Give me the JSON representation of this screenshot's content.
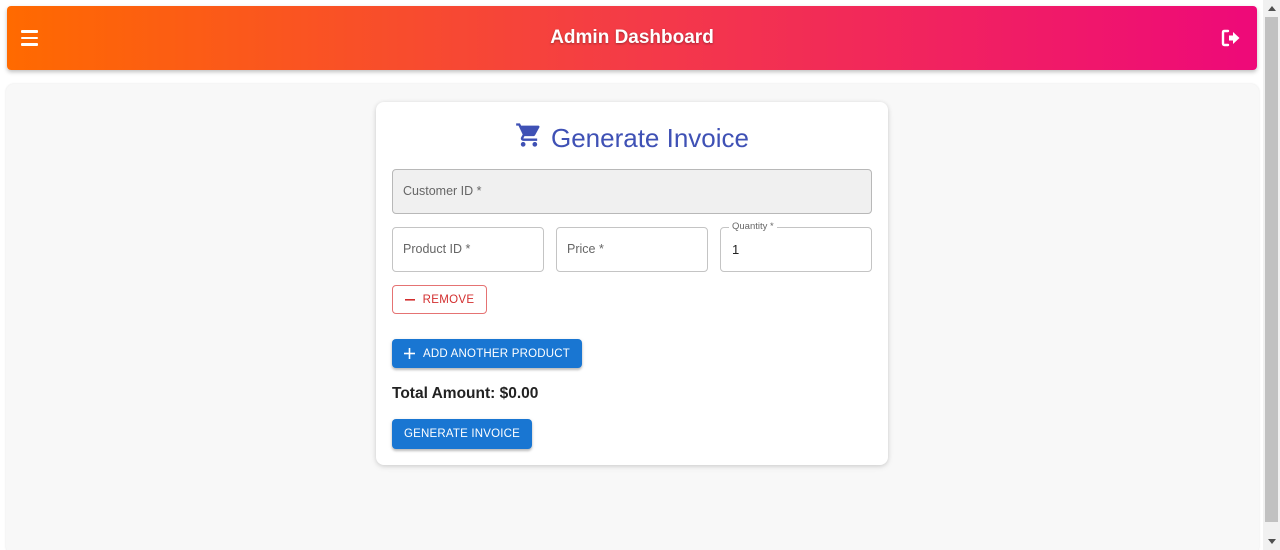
{
  "header": {
    "title": "Admin Dashboard",
    "menu_icon": "menu-icon",
    "logout_icon": "logout-icon",
    "gradient_start": "#ff6a00",
    "gradient_mid": "#f43b47",
    "gradient_end": "#ee0979"
  },
  "invoice": {
    "title": "Generate Invoice",
    "title_icon": "cart-icon",
    "title_color": "#3f51b5",
    "customer_id": {
      "placeholder": "Customer ID *",
      "value": ""
    },
    "product_row": {
      "product_id": {
        "placeholder": "Product ID *",
        "value": ""
      },
      "price": {
        "placeholder": "Price *",
        "value": ""
      },
      "quantity": {
        "label": "Quantity *",
        "value": "1"
      }
    },
    "remove_label": "REMOVE",
    "add_product_label": "ADD ANOTHER PRODUCT",
    "total_label": "Total Amount: $0.00",
    "generate_label": "GENERATE INVOICE",
    "primary_color": "#1976d2",
    "danger_color": "#d32f2f"
  }
}
